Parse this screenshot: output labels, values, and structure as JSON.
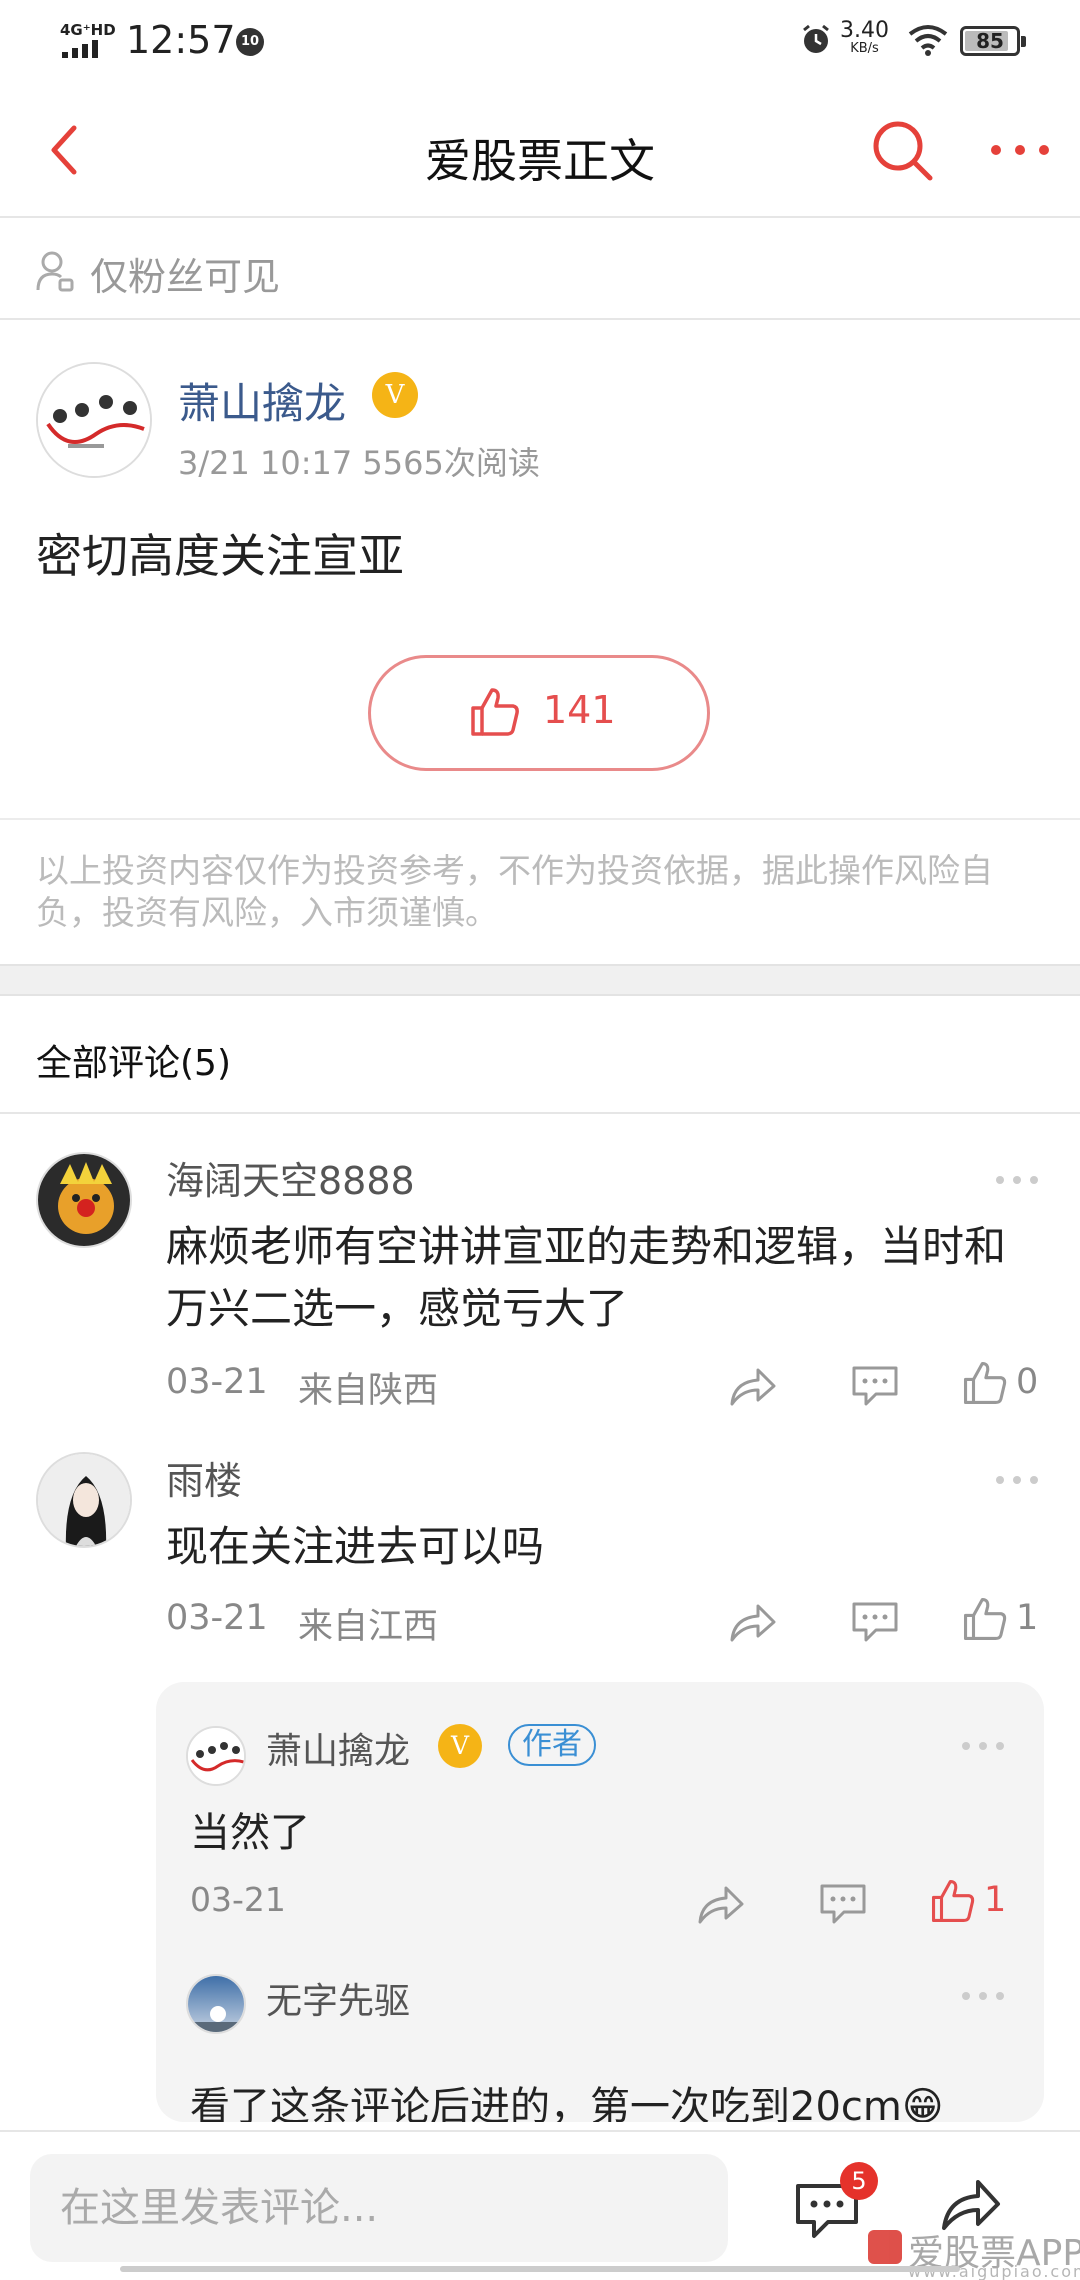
{
  "status_bar": {
    "network": "4G⁺HD",
    "time": "12:57",
    "notification_count": "10",
    "speed": "3.40",
    "speed_unit": "KB/s",
    "battery": "85"
  },
  "nav": {
    "title": "爱股票正文",
    "icons": [
      "back-arrow-icon",
      "search-icon",
      "more-icon"
    ],
    "accent_color": "#e5413a"
  },
  "visibility": {
    "label": "仅粉丝可见",
    "icon": "user-lock-icon"
  },
  "post": {
    "author": "萧山擒龙",
    "verified_badge": "V",
    "meta": "3/21 10:17  5565次阅读",
    "content": "密切高度关注宣亚",
    "likes": "141",
    "disclaimer": "以上投资内容仅作为投资参考，不作为投资依据，据此操作风险自负，投资有风险，入市须谨慎。"
  },
  "comments_section": {
    "header": "全部评论(5)",
    "comments": [
      {
        "user": "海阔天空8888",
        "text": "麻烦老师有空讲讲宣亚的走势和逻辑，当时和万兴二选一，感觉亏大了",
        "date": "03-21",
        "location": "来自陕西",
        "likes": "0"
      },
      {
        "user": "雨楼",
        "text": "现在关注进去可以吗",
        "date": "03-21",
        "location": "来自江西",
        "likes": "1",
        "replies": [
          {
            "user": "萧山擒龙",
            "verified_badge": "V",
            "tag": "作者",
            "text": "当然了",
            "date": "03-21",
            "likes": "1",
            "liked": true
          },
          {
            "user": "无字先驱",
            "text": "看了这条评论后进的，第一次吃到20cm😁"
          }
        ]
      }
    ]
  },
  "bottom_bar": {
    "input_placeholder": "在这里发表评论...",
    "comment_count": "5",
    "watermark": "爱股票APP",
    "watermark_sub": "www.aigupiao.com"
  }
}
